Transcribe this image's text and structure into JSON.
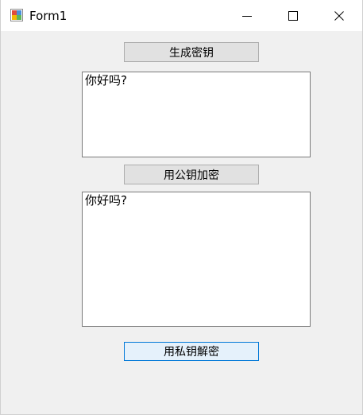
{
  "window": {
    "title": "Form1",
    "icon": "winforms-app-icon",
    "controls": {
      "minimize_icon": "minimize-icon",
      "maximize_icon": "maximize-icon",
      "close_icon": "close-icon"
    }
  },
  "form": {
    "generate_button_label": "生成密钥",
    "top_textbox_value": "你好吗?",
    "encrypt_button_label": "用公钥加密",
    "bottom_textbox_value": "你好吗?",
    "decrypt_button_label": "用私钥解密"
  },
  "colors": {
    "form_background": "#f0f0f0",
    "button_background": "#e1e1e1",
    "focused_button_border": "#0078d7",
    "focused_button_background": "#e5f1fb"
  }
}
